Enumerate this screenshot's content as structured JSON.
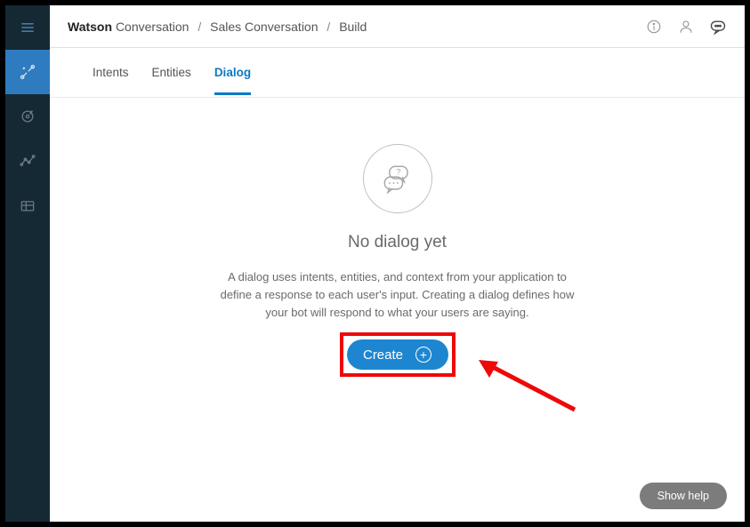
{
  "breadcrumb": {
    "product_bold": "Watson",
    "product_rest": "Conversation",
    "workspace": "Sales Conversation",
    "section": "Build"
  },
  "tabs": [
    {
      "label": "Intents",
      "active": false
    },
    {
      "label": "Entities",
      "active": false
    },
    {
      "label": "Dialog",
      "active": true
    }
  ],
  "empty_state": {
    "title": "No dialog yet",
    "description": "A dialog uses intents, entities, and context from your application to define a response to each user's input. Creating a dialog defines how your bot will respond to what your users are saying.",
    "create_label": "Create"
  },
  "help_button": "Show help",
  "colors": {
    "sidebar": "#152935",
    "accent": "#1e86d0",
    "highlight": "#ee0909"
  }
}
